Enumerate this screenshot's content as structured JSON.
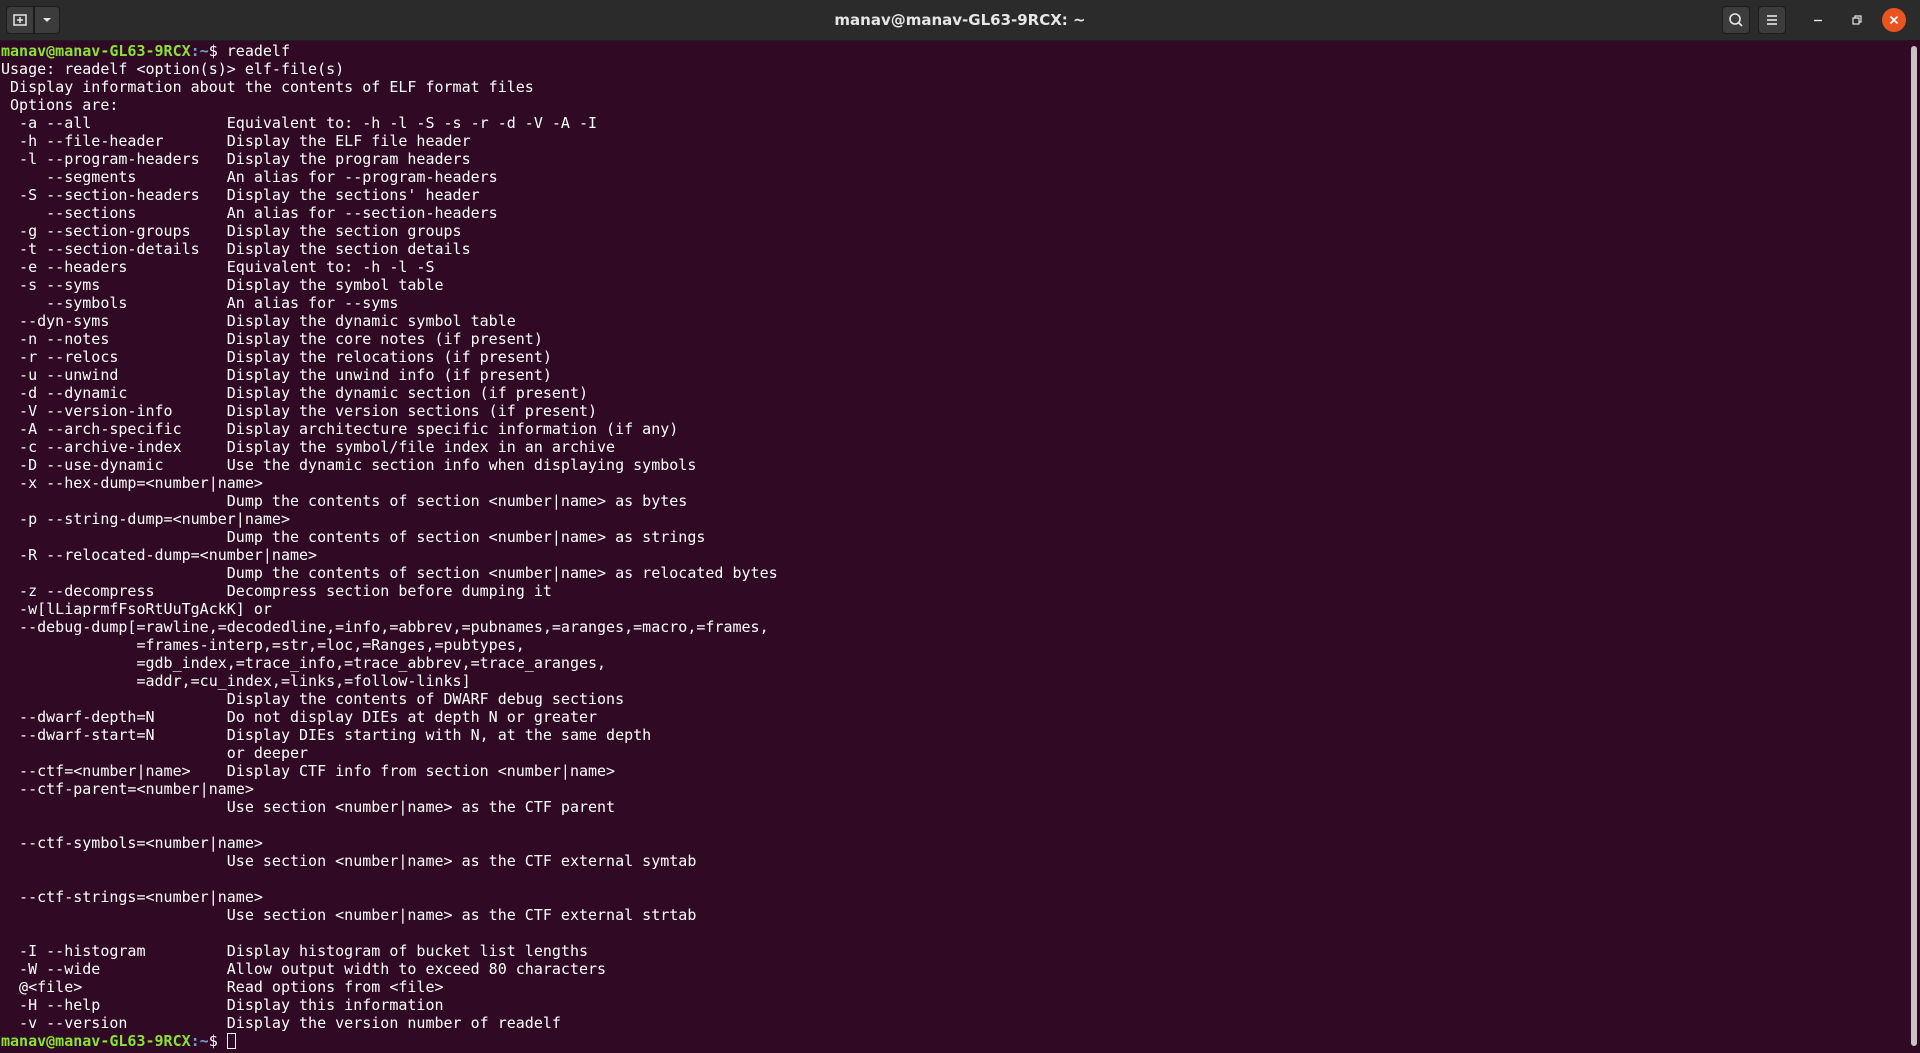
{
  "window": {
    "title": "manav@manav-GL63-9RCX: ~",
    "icons": {
      "new_tab": "new-tab-icon",
      "tab_menu": "chevron-down-icon",
      "search": "search-icon",
      "menu": "hamburger-icon",
      "minimize": "minimize-icon",
      "maximize": "maximize-icon",
      "close": "close-icon"
    }
  },
  "colors": {
    "background": "#300a24",
    "titlebar": "#2b2b2b",
    "prompt_user": "#8ae234",
    "prompt_path": "#729fcf",
    "text": "#ffffff",
    "close_button": "#e95420"
  },
  "terminal": {
    "prompt_user_host": "manav@manav-GL63-9RCX",
    "prompt_path": ":~",
    "prompt_symbol": "$ ",
    "command": "readelf",
    "output": [
      "Usage: readelf <option(s)> elf-file(s)",
      " Display information about the contents of ELF format files",
      " Options are:",
      "  -a --all               Equivalent to: -h -l -S -s -r -d -V -A -I",
      "  -h --file-header       Display the ELF file header",
      "  -l --program-headers   Display the program headers",
      "     --segments          An alias for --program-headers",
      "  -S --section-headers   Display the sections' header",
      "     --sections          An alias for --section-headers",
      "  -g --section-groups    Display the section groups",
      "  -t --section-details   Display the section details",
      "  -e --headers           Equivalent to: -h -l -S",
      "  -s --syms              Display the symbol table",
      "     --symbols           An alias for --syms",
      "  --dyn-syms             Display the dynamic symbol table",
      "  -n --notes             Display the core notes (if present)",
      "  -r --relocs            Display the relocations (if present)",
      "  -u --unwind            Display the unwind info (if present)",
      "  -d --dynamic           Display the dynamic section (if present)",
      "  -V --version-info      Display the version sections (if present)",
      "  -A --arch-specific     Display architecture specific information (if any)",
      "  -c --archive-index     Display the symbol/file index in an archive",
      "  -D --use-dynamic       Use the dynamic section info when displaying symbols",
      "  -x --hex-dump=<number|name>",
      "                         Dump the contents of section <number|name> as bytes",
      "  -p --string-dump=<number|name>",
      "                         Dump the contents of section <number|name> as strings",
      "  -R --relocated-dump=<number|name>",
      "                         Dump the contents of section <number|name> as relocated bytes",
      "  -z --decompress        Decompress section before dumping it",
      "  -w[lLiaprmfFsoRtUuTgAckK] or",
      "  --debug-dump[=rawline,=decodedline,=info,=abbrev,=pubnames,=aranges,=macro,=frames,",
      "               =frames-interp,=str,=loc,=Ranges,=pubtypes,",
      "               =gdb_index,=trace_info,=trace_abbrev,=trace_aranges,",
      "               =addr,=cu_index,=links,=follow-links]",
      "                         Display the contents of DWARF debug sections",
      "  --dwarf-depth=N        Do not display DIEs at depth N or greater",
      "  --dwarf-start=N        Display DIEs starting with N, at the same depth",
      "                         or deeper",
      "  --ctf=<number|name>    Display CTF info from section <number|name>",
      "  --ctf-parent=<number|name>",
      "                         Use section <number|name> as the CTF parent",
      "",
      "  --ctf-symbols=<number|name>",
      "                         Use section <number|name> as the CTF external symtab",
      "",
      "  --ctf-strings=<number|name>",
      "                         Use section <number|name> as the CTF external strtab",
      "",
      "  -I --histogram         Display histogram of bucket list lengths",
      "  -W --wide              Allow output width to exceed 80 characters",
      "  @<file>                Read options from <file>",
      "  -H --help              Display this information",
      "  -v --version           Display the version number of readelf"
    ]
  }
}
